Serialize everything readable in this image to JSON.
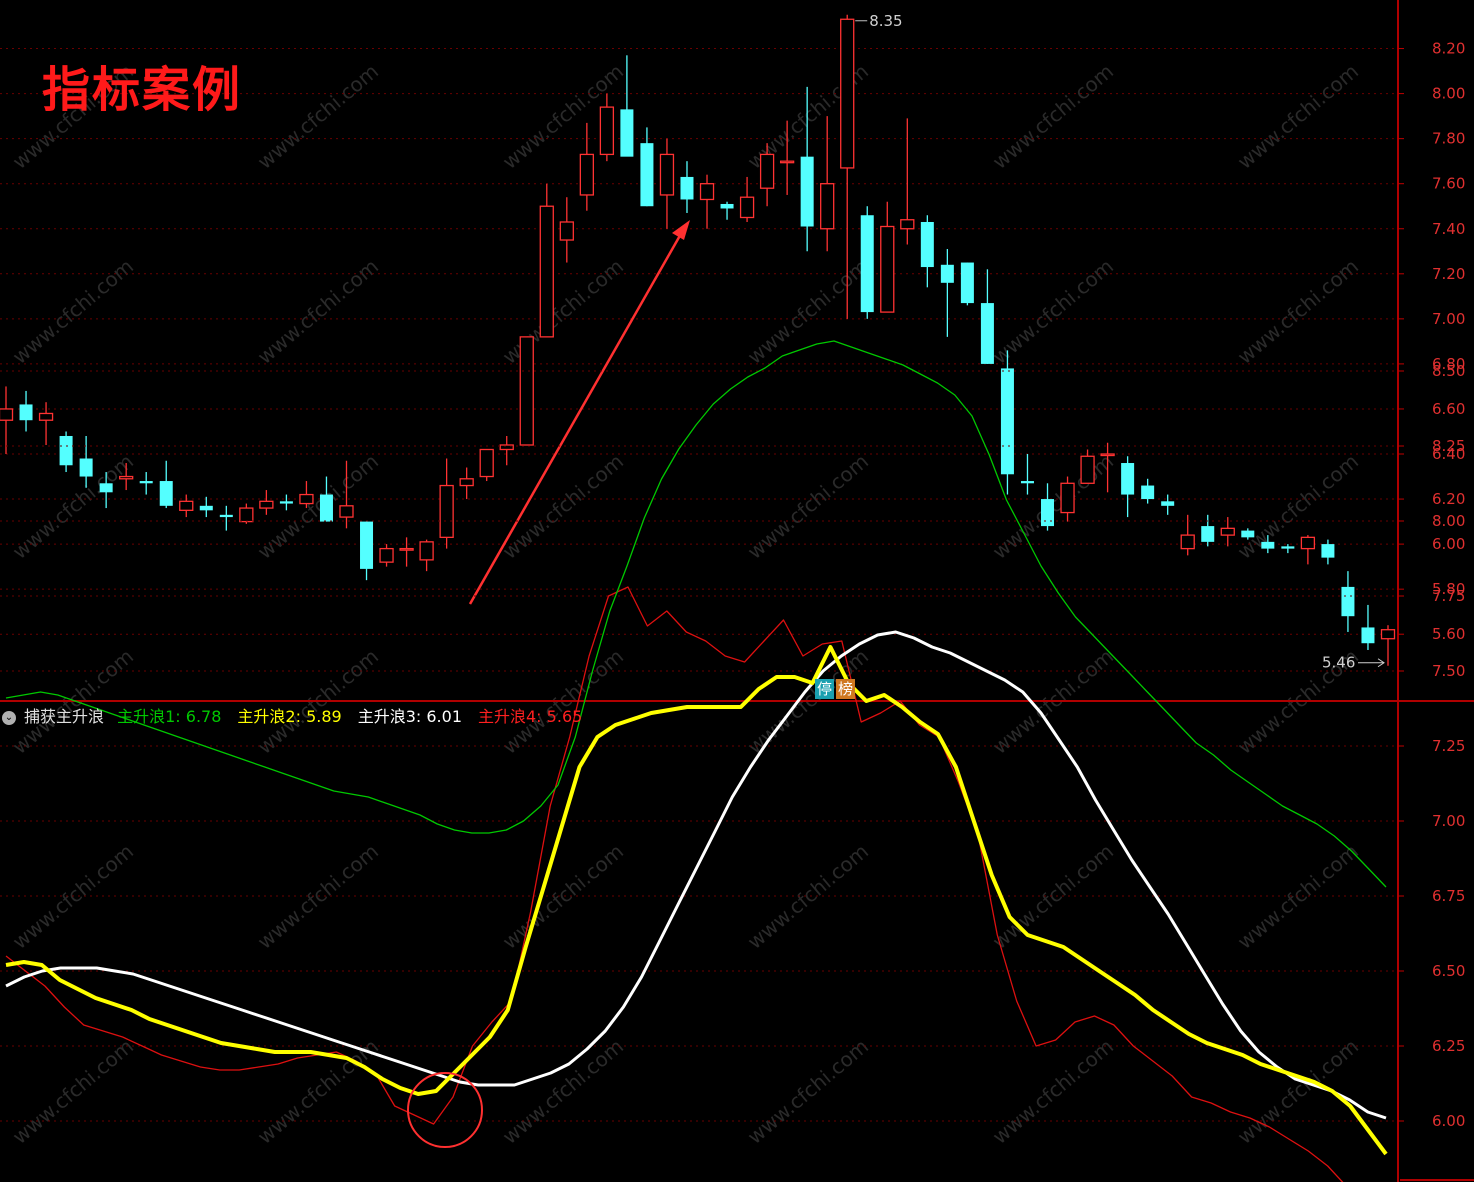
{
  "title": "指标案例",
  "watermark": "www.cfchi.com",
  "badges": [
    "停",
    "榜"
  ],
  "indicator_legend": {
    "name": "捕获主升浪",
    "items": [
      {
        "label": "主升浪1: ",
        "value": "6.78",
        "color": "#00c800"
      },
      {
        "label": "主升浪2: ",
        "value": "5.89",
        "color": "#ffff00"
      },
      {
        "label": "主升浪3: ",
        "value": "6.01",
        "color": "#ffffff"
      },
      {
        "label": "主升浪4: ",
        "value": "5.65",
        "color": "#ff2020"
      }
    ]
  },
  "chart_data": [
    {
      "type": "candlestick",
      "ylim": [
        5.45,
        8.38
      ],
      "yticks": [
        5.6,
        5.8,
        6.0,
        6.2,
        6.4,
        6.6,
        6.8,
        7.0,
        7.2,
        7.4,
        7.6,
        7.8,
        8.0,
        8.2
      ],
      "annotations": [
        {
          "text": "8.35",
          "value": 8.35
        },
        {
          "text": "5.46",
          "value": 5.46
        }
      ],
      "up_color": "#ff3232",
      "down_color": "#54ffff",
      "ohlc": [
        [
          6.55,
          6.7,
          6.4,
          6.6
        ],
        [
          6.62,
          6.68,
          6.5,
          6.55
        ],
        [
          6.55,
          6.63,
          6.44,
          6.58
        ],
        [
          6.48,
          6.5,
          6.32,
          6.35
        ],
        [
          6.38,
          6.48,
          6.25,
          6.3
        ],
        [
          6.27,
          6.32,
          6.16,
          6.23
        ],
        [
          6.29,
          6.36,
          6.24,
          6.3
        ],
        [
          6.28,
          6.32,
          6.22,
          6.27
        ],
        [
          6.28,
          6.37,
          6.16,
          6.17
        ],
        [
          6.15,
          6.22,
          6.12,
          6.19
        ],
        [
          6.17,
          6.21,
          6.12,
          6.15
        ],
        [
          6.13,
          6.17,
          6.06,
          6.12
        ],
        [
          6.1,
          6.18,
          6.09,
          6.16
        ],
        [
          6.16,
          6.24,
          6.13,
          6.19
        ],
        [
          6.19,
          6.22,
          6.15,
          6.18
        ],
        [
          6.18,
          6.28,
          6.16,
          6.22
        ],
        [
          6.22,
          6.3,
          6.1,
          6.1
        ],
        [
          6.12,
          6.37,
          6.07,
          6.17
        ],
        [
          6.1,
          6.1,
          5.84,
          5.89
        ],
        [
          5.92,
          6.0,
          5.9,
          5.98
        ],
        [
          5.98,
          6.03,
          5.9,
          5.98
        ],
        [
          5.93,
          6.02,
          5.88,
          6.01
        ],
        [
          6.03,
          6.38,
          5.98,
          6.26
        ],
        [
          6.26,
          6.34,
          6.2,
          6.29
        ],
        [
          6.3,
          6.42,
          6.28,
          6.42
        ],
        [
          6.42,
          6.48,
          6.35,
          6.44
        ],
        [
          6.44,
          6.92,
          6.44,
          6.92
        ],
        [
          6.92,
          7.6,
          6.92,
          7.5
        ],
        [
          7.35,
          7.54,
          7.25,
          7.43
        ],
        [
          7.55,
          7.87,
          7.48,
          7.73
        ],
        [
          7.73,
          8.0,
          7.7,
          7.94
        ],
        [
          7.93,
          8.17,
          7.83,
          7.72
        ],
        [
          7.78,
          7.85,
          7.5,
          7.5
        ],
        [
          7.55,
          7.8,
          7.4,
          7.73
        ],
        [
          7.63,
          7.7,
          7.47,
          7.53
        ],
        [
          7.53,
          7.64,
          7.4,
          7.6
        ],
        [
          7.51,
          7.52,
          7.44,
          7.49
        ],
        [
          7.45,
          7.63,
          7.43,
          7.54
        ],
        [
          7.58,
          7.78,
          7.5,
          7.73
        ],
        [
          7.7,
          7.88,
          7.55,
          7.7
        ],
        [
          7.72,
          8.03,
          7.3,
          7.41
        ],
        [
          7.4,
          7.9,
          7.3,
          7.6
        ],
        [
          7.67,
          8.35,
          7.0,
          8.33
        ],
        [
          7.46,
          7.5,
          7.0,
          7.03
        ],
        [
          7.03,
          7.52,
          7.03,
          7.41
        ],
        [
          7.4,
          7.89,
          7.33,
          7.44
        ],
        [
          7.43,
          7.46,
          7.14,
          7.23
        ],
        [
          7.24,
          7.31,
          6.92,
          7.16
        ],
        [
          7.25,
          7.25,
          7.06,
          7.07
        ],
        [
          7.07,
          7.22,
          6.8,
          6.8
        ],
        [
          6.78,
          6.86,
          6.22,
          6.31
        ],
        [
          6.28,
          6.4,
          6.22,
          6.27
        ],
        [
          6.2,
          6.27,
          6.06,
          6.08
        ],
        [
          6.14,
          6.3,
          6.1,
          6.27
        ],
        [
          6.27,
          6.42,
          6.27,
          6.39
        ],
        [
          6.4,
          6.45,
          6.23,
          6.4
        ],
        [
          6.36,
          6.39,
          6.12,
          6.22
        ],
        [
          6.26,
          6.29,
          6.18,
          6.2
        ],
        [
          6.19,
          6.22,
          6.13,
          6.17
        ],
        [
          5.98,
          6.13,
          5.95,
          6.04
        ],
        [
          6.08,
          6.13,
          5.99,
          6.01
        ],
        [
          6.04,
          6.12,
          5.99,
          6.07
        ],
        [
          6.06,
          6.07,
          6.02,
          6.03
        ],
        [
          6.01,
          6.04,
          5.96,
          5.98
        ],
        [
          5.99,
          6.0,
          5.96,
          5.98
        ],
        [
          5.98,
          6.04,
          5.91,
          6.03
        ],
        [
          6.0,
          6.02,
          5.91,
          5.94
        ],
        [
          5.81,
          5.88,
          5.61,
          5.68
        ],
        [
          5.63,
          5.73,
          5.53,
          5.56
        ],
        [
          5.58,
          5.64,
          5.46,
          5.62
        ]
      ]
    },
    {
      "type": "line",
      "ylim": [
        5.6,
        8.85
      ],
      "yticks": [
        6.0,
        6.25,
        6.5,
        6.75,
        7.0,
        7.25,
        7.5,
        7.75,
        8.0,
        8.25,
        8.5
      ],
      "series": [
        {
          "name": "主升浪1",
          "color": "#00c800",
          "width": 1.3,
          "values": [
            7.41,
            7.42,
            7.43,
            7.42,
            7.4,
            7.38,
            7.36,
            7.34,
            7.32,
            7.3,
            7.28,
            7.26,
            7.24,
            7.22,
            7.2,
            7.18,
            7.16,
            7.14,
            7.12,
            7.1,
            7.09,
            7.08,
            7.06,
            7.04,
            7.02,
            6.99,
            6.97,
            6.96,
            6.96,
            6.97,
            7.0,
            7.05,
            7.12,
            7.28,
            7.5,
            7.7,
            7.85,
            8.01,
            8.14,
            8.24,
            8.32,
            8.39,
            8.44,
            8.48,
            8.51,
            8.55,
            8.57,
            8.59,
            8.6,
            8.58,
            8.56,
            8.54,
            8.52,
            8.49,
            8.46,
            8.42,
            8.35,
            8.22,
            8.07,
            7.96,
            7.85,
            7.76,
            7.68,
            7.62,
            7.56,
            7.5,
            7.44,
            7.38,
            7.32,
            7.26,
            7.22,
            7.17,
            7.13,
            7.09,
            7.05,
            7.02,
            6.99,
            6.95,
            6.9,
            6.84,
            6.78
          ]
        },
        {
          "name": "主升浪2",
          "color": "#ffff00",
          "width": 4,
          "values": [
            6.52,
            6.53,
            6.52,
            6.47,
            6.44,
            6.41,
            6.39,
            6.37,
            6.34,
            6.32,
            6.3,
            6.28,
            6.26,
            6.25,
            6.24,
            6.23,
            6.23,
            6.23,
            6.22,
            6.21,
            6.18,
            6.14,
            6.11,
            6.09,
            6.1,
            6.16,
            6.22,
            6.28,
            6.37,
            6.58,
            6.78,
            6.98,
            7.18,
            7.28,
            7.32,
            7.34,
            7.36,
            7.37,
            7.38,
            7.38,
            7.38,
            7.38,
            7.44,
            7.48,
            7.48,
            7.46,
            7.58,
            7.46,
            7.4,
            7.42,
            7.38,
            7.33,
            7.29,
            7.18,
            7.0,
            6.82,
            6.68,
            6.62,
            6.6,
            6.58,
            6.54,
            6.5,
            6.46,
            6.42,
            6.37,
            6.33,
            6.29,
            6.26,
            6.24,
            6.22,
            6.19,
            6.17,
            6.15,
            6.13,
            6.1,
            6.05,
            5.97,
            5.89
          ]
        },
        {
          "name": "主升浪3",
          "color": "#ffffff",
          "width": 3,
          "values": [
            6.45,
            6.48,
            6.5,
            6.51,
            6.51,
            6.51,
            6.5,
            6.49,
            6.47,
            6.45,
            6.43,
            6.41,
            6.39,
            6.37,
            6.35,
            6.33,
            6.31,
            6.29,
            6.27,
            6.25,
            6.23,
            6.21,
            6.19,
            6.17,
            6.15,
            6.13,
            6.12,
            6.12,
            6.12,
            6.14,
            6.16,
            6.19,
            6.24,
            6.3,
            6.38,
            6.48,
            6.6,
            6.72,
            6.84,
            6.96,
            7.08,
            7.18,
            7.27,
            7.35,
            7.43,
            7.5,
            7.55,
            7.59,
            7.62,
            7.63,
            7.61,
            7.58,
            7.56,
            7.53,
            7.5,
            7.47,
            7.43,
            7.36,
            7.27,
            7.18,
            7.07,
            6.97,
            6.87,
            6.78,
            6.69,
            6.59,
            6.49,
            6.39,
            6.3,
            6.23,
            6.18,
            6.14,
            6.12,
            6.1,
            6.07,
            6.03,
            6.01
          ]
        },
        {
          "name": "主升浪4",
          "color": "#dd1010",
          "width": 1.3,
          "values": [
            6.55,
            6.5,
            6.45,
            6.38,
            6.32,
            6.3,
            6.28,
            6.25,
            6.22,
            6.2,
            6.18,
            6.17,
            6.17,
            6.18,
            6.19,
            6.21,
            6.22,
            6.23,
            6.2,
            6.16,
            6.05,
            6.02,
            5.99,
            6.08,
            6.25,
            6.33,
            6.4,
            6.7,
            7.05,
            7.28,
            7.55,
            7.75,
            7.78,
            7.65,
            7.7,
            7.63,
            7.6,
            7.55,
            7.53,
            7.6,
            7.67,
            7.55,
            7.59,
            7.6,
            7.33,
            7.36,
            7.4,
            7.32,
            7.28,
            7.13,
            6.96,
            6.62,
            6.4,
            6.25,
            6.27,
            6.33,
            6.35,
            6.32,
            6.25,
            6.2,
            6.15,
            6.08,
            6.06,
            6.03,
            6.01,
            5.98,
            5.94,
            5.9,
            5.85,
            5.78,
            5.7,
            5.65
          ]
        }
      ]
    }
  ]
}
